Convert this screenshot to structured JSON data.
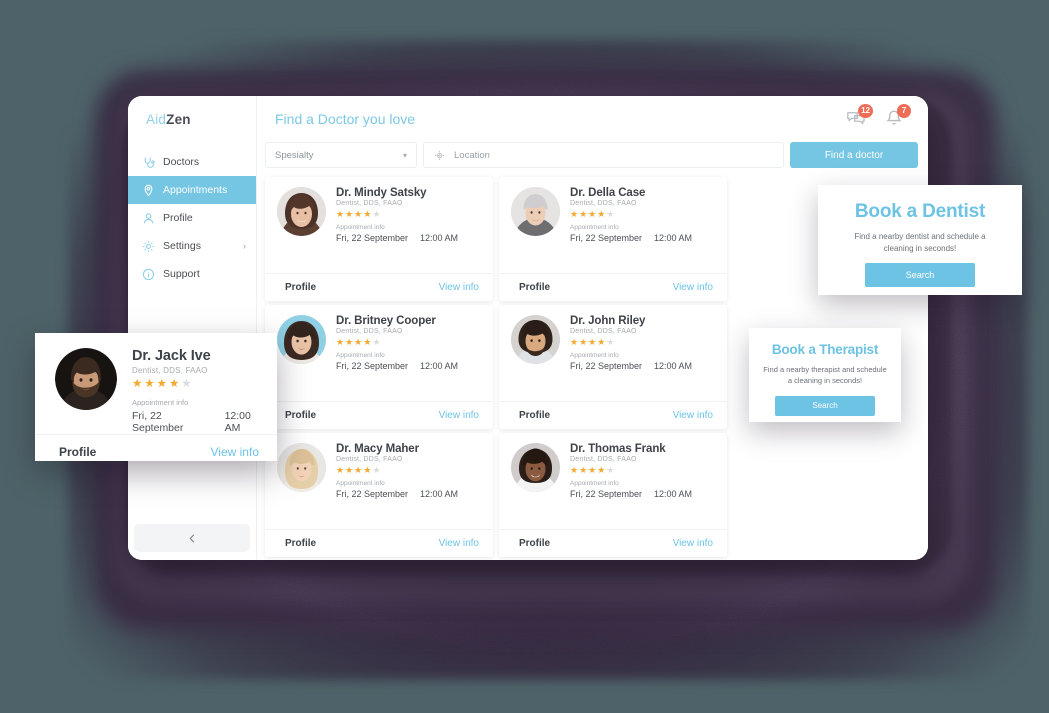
{
  "brand": {
    "part1": "Aid",
    "part2": "Zen"
  },
  "sidebar": {
    "items": [
      {
        "label": "Doctors",
        "icon": "stethoscope-icon",
        "active": false,
        "chevron": ""
      },
      {
        "label": "Appointments",
        "icon": "map-pin-icon",
        "active": true,
        "chevron": ""
      },
      {
        "label": "Profile",
        "icon": "user-icon",
        "active": false,
        "chevron": ""
      },
      {
        "label": "Settings",
        "icon": "gear-icon",
        "active": false,
        "chevron": "›"
      },
      {
        "label": "Support",
        "icon": "info-icon",
        "active": false,
        "chevron": ""
      }
    ],
    "collapse_icon": "chevron-left-icon"
  },
  "header": {
    "title": "Find a Doctor you love",
    "messages_icon": "chat-bubbles-icon",
    "messages_badge": "12",
    "notifications_icon": "bell-icon",
    "notifications_badge": "7"
  },
  "search": {
    "specialty_value": "Spesialty",
    "specialty_caret": "chevron-down-icon",
    "location_icon": "location-target-icon",
    "location_placeholder": "Location",
    "location_value": "",
    "find_button": "Find a doctor"
  },
  "labels": {
    "specialty_text": "Dentist, DDS, FAAO",
    "appointment_info": "Appointment info",
    "profile": "Profile",
    "view_info": "View info",
    "date": "Fri, 22 September",
    "time": "12:00 AM"
  },
  "doctors": [
    {
      "name": "Dr. Mindy Satsky",
      "specialty": "Dentist, DDS, FAAO",
      "rating": 4,
      "max_rating": 5,
      "appointment_label": "Appointment info",
      "date": "Fri, 22 September",
      "time": "12:00 AM",
      "profile": "Profile",
      "view_info": "View info",
      "avatar": "woman-brown-hair"
    },
    {
      "name": "Dr. Della Case",
      "specialty": "Dentist, DDS, FAAO",
      "rating": 4,
      "max_rating": 5,
      "appointment_label": "Appointment info",
      "date": "Fri, 22 September",
      "time": "12:00 AM",
      "profile": "Profile",
      "view_info": "View info",
      "avatar": "woman-grey-hair"
    },
    {
      "name": "Dr. Britney Cooper",
      "specialty": "Dentist, DDS, FAAO",
      "rating": 4,
      "max_rating": 5,
      "appointment_label": "Appointment info",
      "date": "Fri, 22 September",
      "time": "12:00 AM",
      "profile": "Profile",
      "view_info": "View info",
      "avatar": "woman-dark-hair"
    },
    {
      "name": "Dr. John Riley",
      "specialty": "Dentist, DDS, FAAO",
      "rating": 4,
      "max_rating": 5,
      "appointment_label": "Appointment info",
      "date": "Fri, 22 September",
      "time": "12:00 AM",
      "profile": "Profile",
      "view_info": "View info",
      "avatar": "man-curly-hair"
    },
    {
      "name": "Dr. Macy Maher",
      "specialty": "Dentist, DDS, FAAO",
      "rating": 4,
      "max_rating": 5,
      "appointment_label": "Appointment info",
      "date": "Fri, 22 September",
      "time": "12:00 AM",
      "profile": "Profile",
      "view_info": "View info",
      "avatar": "woman-blonde"
    },
    {
      "name": "Dr. Thomas Frank",
      "specialty": "Dentist, DDS, FAAO",
      "rating": 4,
      "max_rating": 5,
      "appointment_label": "Appointment info",
      "date": "Fri, 22 September",
      "time": "12:00 AM",
      "profile": "Profile",
      "view_info": "View info",
      "avatar": "man-smiling"
    }
  ],
  "featured_card": {
    "name": "Dr. Jack Ive",
    "specialty": "Dentist, DDS, FAAO",
    "rating": 4,
    "max_rating": 5,
    "appointment_label": "Appointment info",
    "date": "Fri, 22 September",
    "time": "12:00 AM",
    "profile": "Profile",
    "view_info": "View info",
    "avatar": "man-beard"
  },
  "promos": [
    {
      "title": "Book a Dentist",
      "description": "Find a nearby dentist and schedule a cleaning in seconds!",
      "button": "Search"
    },
    {
      "title": "Book a Therapist",
      "description": "Find a nearby therapist and schedule a cleaning in seconds!",
      "button": "Search"
    }
  ],
  "colors": {
    "accent": "#6dc3e4",
    "accent_dark": "#74c6e3",
    "badge": "#ef6c57",
    "star": "#f2a92f",
    "star_off": "#d9dde0",
    "text": "#3d4349",
    "muted": "#a6acb2",
    "backdrop": "#4e6369",
    "shadow": "#30243a"
  }
}
